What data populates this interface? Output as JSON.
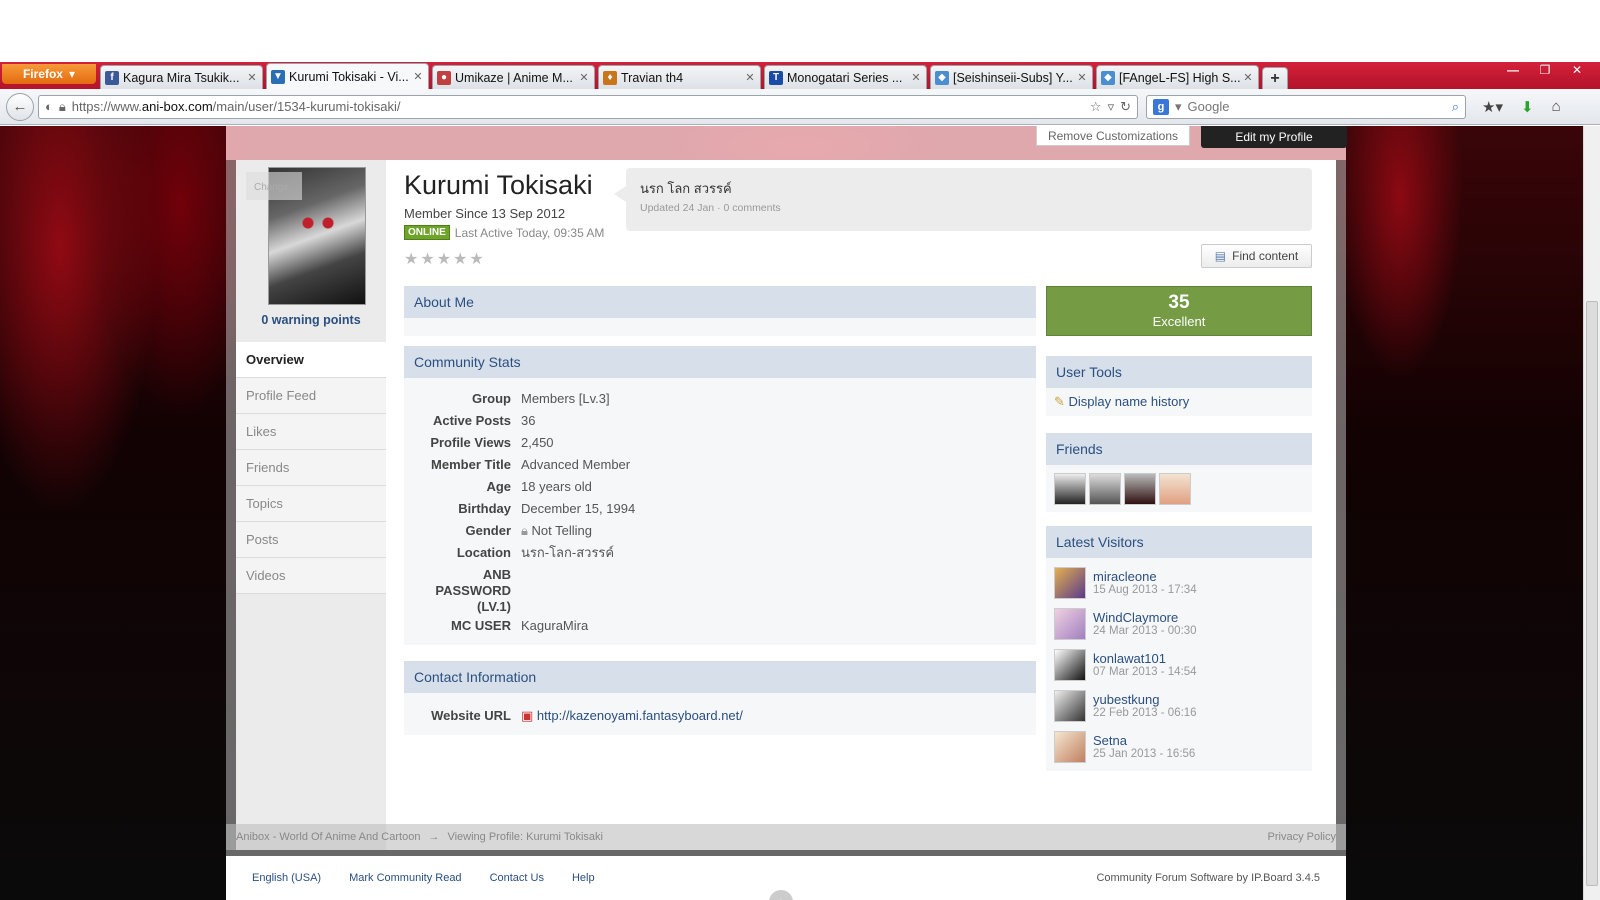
{
  "browser": {
    "menu_button": "Firefox",
    "tabs": [
      {
        "title": "Kagura Mira Tsukik...",
        "icon": "facebook-icon",
        "color": "#3b5998"
      },
      {
        "title": "Kurumi Tokisaki - Vi...",
        "icon": "anibox-icon",
        "color": "#2a6fb3"
      },
      {
        "title": "Umikaze | Anime M...",
        "icon": "umikaze-icon",
        "color": "#c04040"
      },
      {
        "title": "Travian th4",
        "icon": "travian-icon",
        "color": "#c8751c"
      },
      {
        "title": "Monogatari Series ...",
        "icon": "t-icon",
        "color": "#1a4ba8"
      },
      {
        "title": "[Seishinseii-Subs] Y...",
        "icon": "cat-icon",
        "color": "#4a8ed0"
      },
      {
        "title": "[FAngeL-FS] High S...",
        "icon": "cat-icon",
        "color": "#4a8ed0"
      }
    ],
    "url_prefix": "https://www.",
    "url_domain": "ani-box.com",
    "url_path": "/main/user/1534-kurumi-tokisaki/",
    "search_placeholder": "Google"
  },
  "profile": {
    "remove_customizations": "Remove Customizations",
    "edit_profile": "Edit my Profile",
    "change_label": "Change",
    "warning_points": "0 warning points",
    "name": "Kurumi Tokisaki",
    "member_since": "Member Since 13 Sep 2012",
    "online_badge": "ONLINE",
    "last_active": "Last Active Today, 09:35 AM",
    "rating_stars": 0,
    "status_text": "นรก โลก สวรรค์",
    "status_meta": "Updated 24 Jan · 0 comments",
    "find_content": "Find content"
  },
  "sidenav": [
    "Overview",
    "Profile Feed",
    "Likes",
    "Friends",
    "Topics",
    "Posts",
    "Videos"
  ],
  "about": {
    "title": "About Me"
  },
  "stats": {
    "title": "Community Stats",
    "rows": [
      {
        "label": "Group",
        "value": "Members [Lv.3]"
      },
      {
        "label": "Active Posts",
        "value": "36"
      },
      {
        "label": "Profile Views",
        "value": "2,450"
      },
      {
        "label": "Member Title",
        "value": "Advanced Member"
      },
      {
        "label": "Age",
        "value": "18 years old"
      },
      {
        "label": "Birthday",
        "value": "December 15, 1994"
      },
      {
        "label": "Gender",
        "value": "Not Telling"
      },
      {
        "label": "Location",
        "value": "นรก-โลก-สวรรค์"
      },
      {
        "label": "ANB PASSWORD (LV.1)",
        "value": ""
      },
      {
        "label": "MC USER",
        "value": "KaguraMira"
      }
    ]
  },
  "contact": {
    "title": "Contact Information",
    "label": "Website URL",
    "url": "http://kazenoyami.fantasyboard.net/"
  },
  "reputation": {
    "value": "35",
    "label": "Excellent",
    "color": "#759b45"
  },
  "user_tools": {
    "title": "User Tools",
    "link": "Display name history"
  },
  "friends": {
    "title": "Friends"
  },
  "visitors": {
    "title": "Latest Visitors",
    "items": [
      {
        "name": "miracleone",
        "date": "15 Aug 2013 - 17:34"
      },
      {
        "name": "WindClaymore",
        "date": "24 Mar 2013 - 00:30"
      },
      {
        "name": "konlawat101",
        "date": "07 Mar 2013 - 14:54"
      },
      {
        "name": "yubestkung",
        "date": "22 Feb 2013 - 06:16"
      },
      {
        "name": "Setna",
        "date": "25 Jan 2013 - 16:56"
      }
    ]
  },
  "footer": {
    "breadcrumb_home": "Anibox - World Of Anime And Cartoon",
    "breadcrumb_sep": "→",
    "breadcrumb_current": "Viewing Profile: Kurumi Tokisaki",
    "privacy": "Privacy Policy",
    "language": "English (USA)",
    "mark_read": "Mark Community Read",
    "contact_us": "Contact Us",
    "help": "Help",
    "credit": "Community Forum Software by IP.Board 3.4.5"
  }
}
